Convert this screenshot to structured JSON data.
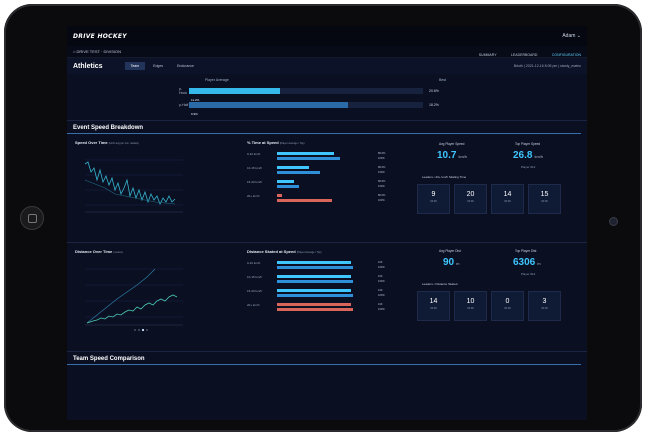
{
  "app": {
    "logo": "DRIVE HOCKEY",
    "user": "Adam"
  },
  "breadcrumb": "DRIVE TEST · DIVISION",
  "nav_tabs": [
    {
      "label": "SUMMARY"
    },
    {
      "label": "LEADERBOARD"
    },
    {
      "label": "CONFIGURATION"
    }
  ],
  "page": {
    "title": "Athletics",
    "meta": "Bdoth | 2021-12-16 8:05 pm | stanly_mateo"
  },
  "tabs": [
    {
      "label": "Team"
    },
    {
      "label": "Edges"
    },
    {
      "label": "Endurance"
    }
  ],
  "average": {
    "header_left": "Player Average",
    "header_right": "Best",
    "rows": [
      {
        "label": "p-Hock",
        "bar_text": "11.2%",
        "fraction": 0.39,
        "value": "20.6%"
      },
      {
        "label": "p-Half",
        "bar_text": "9.9%",
        "fraction": 0.68,
        "value": "18.2%"
      }
    ]
  },
  "section_event": "Event Speed Breakdown",
  "section_team": "Team Speed Comparison",
  "speed_panel": {
    "chart_title": "Speed Over Time",
    "chart_note": "(km/h avg per min, ranked)",
    "pct_title": "% Time at Speed",
    "pct_note": "(Player Average / Top)",
    "pct_rows": [
      {
        "label": "0-10 km/h",
        "a": 0.6,
        "b": 0.66,
        "va": "80.0%",
        "vb": "100%"
      },
      {
        "label": "10-15 km/h",
        "a": 0.34,
        "b": 0.45,
        "va": "80.0%",
        "vb": "100%"
      },
      {
        "label": "15-20 km/h",
        "a": 0.18,
        "b": 0.23,
        "va": "80.0%",
        "vb": "100%"
      },
      {
        "label": "20+ km/h",
        "a": 0.05,
        "b": 0.58,
        "va": "80.0%",
        "vb": "100%"
      }
    ],
    "avg_label": "Avg Player Speed",
    "avg_value": "10.7",
    "avg_unit": "km/h",
    "top_label": "Top Player Speed",
    "top_value": "26.8",
    "top_unit": "km/h",
    "top_sub": "Player #12",
    "tiles_label": "Leaders • 20+ km/h Skating Time",
    "tiles": [
      {
        "n": "9",
        "s": "00:00"
      },
      {
        "n": "20",
        "s": "00:00"
      },
      {
        "n": "14",
        "s": "00:00"
      },
      {
        "n": "15",
        "s": "00:00"
      }
    ]
  },
  "distance_panel": {
    "chart_title": "Distance Over Time",
    "chart_note": "(metres)",
    "pct_title": "Distance Skated at Speed",
    "pct_note": "(Player Average / Top)",
    "pct_rows": [
      {
        "label": "0-10 km/h",
        "a": 0.78,
        "b": 0.8,
        "va": "100",
        "vb": "100%"
      },
      {
        "label": "10-15 km/h",
        "a": 0.78,
        "b": 0.8,
        "va": "100",
        "vb": "100%"
      },
      {
        "label": "15-20 km/h",
        "a": 0.78,
        "b": 0.8,
        "va": "100",
        "vb": "100%"
      },
      {
        "label": "20+ km/h",
        "a": 0.78,
        "b": 0.8,
        "va": "100",
        "vb": "100%"
      }
    ],
    "avg_label": "Avg Player Dist",
    "avg_value": "90",
    "avg_unit": "m",
    "top_label": "Top Player Dist",
    "top_value": "6306",
    "top_unit": "m",
    "top_sub": "Player #12",
    "tiles_label": "Leaders • Distance Skated",
    "tiles": [
      {
        "n": "14",
        "s": "00:00"
      },
      {
        "n": "10",
        "s": "00:00"
      },
      {
        "n": "0",
        "s": "00:00"
      },
      {
        "n": "3",
        "s": "00:00"
      }
    ]
  },
  "colors": {
    "accent": "#3fc6ff",
    "bar_blue": "#2f8fd8",
    "bar_red": "#d9645a",
    "bg": "#0a0f22"
  }
}
